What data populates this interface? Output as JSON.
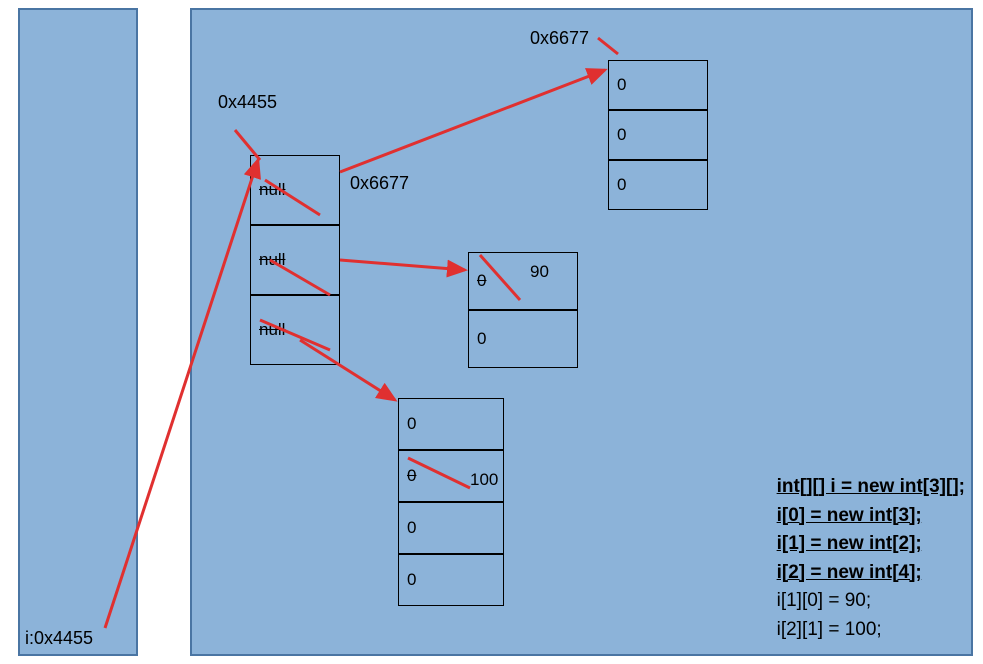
{
  "stack": {
    "variable_label": "i:0x4455"
  },
  "heap": {
    "outer_address": "0x4455",
    "outer_cells": [
      "null",
      "null",
      "null"
    ],
    "outer_cell0_new": "0x6677",
    "inner0_address": "0x6677",
    "inner0_cells": [
      "0",
      "0",
      "0"
    ],
    "inner1_cells": [
      "0",
      "0"
    ],
    "inner1_cell0_new": "90",
    "inner2_cells": [
      "0",
      "0",
      "0",
      "0"
    ],
    "inner2_cell1_new": "100"
  },
  "code": {
    "line1": "int[][] i = new int[3][];",
    "line2": "i[0] = new int[3];",
    "line3": "i[1] = new int[2];",
    "line4": "i[2] = new int[4];",
    "line5": "i[1][0] = 90;",
    "line6": "i[2][1] = 100;"
  }
}
